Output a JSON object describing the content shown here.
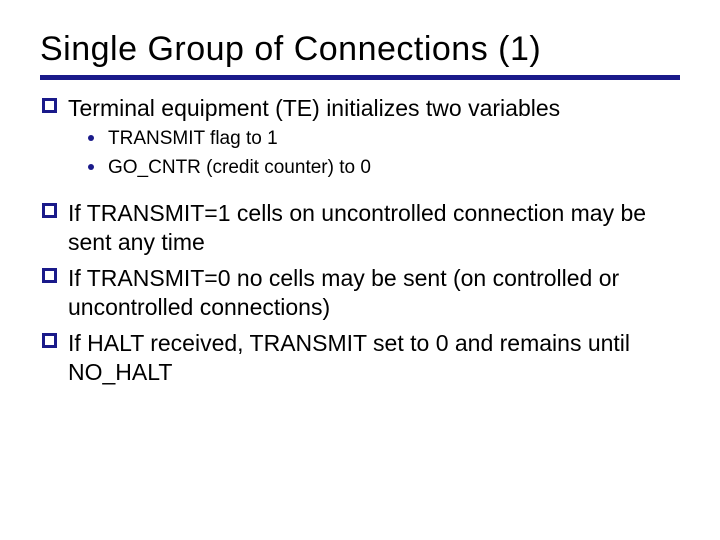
{
  "title": "Single Group of Connections (1)",
  "items": [
    {
      "level": 1,
      "text": "Terminal equipment (TE) initializes two variables"
    },
    {
      "level": 2,
      "text": "TRANSMIT flag to 1"
    },
    {
      "level": 2,
      "text": "GO_CNTR (credit counter) to 0"
    },
    {
      "level": 1,
      "text": "If TRANSMIT=1 cells on uncontrolled connection may be sent any time"
    },
    {
      "level": 1,
      "text": "If TRANSMIT=0 no cells may be sent (on controlled or uncontrolled connections)"
    },
    {
      "level": 1,
      "text": "If HALT received, TRANSMIT set to 0 and remains until NO_HALT"
    }
  ]
}
